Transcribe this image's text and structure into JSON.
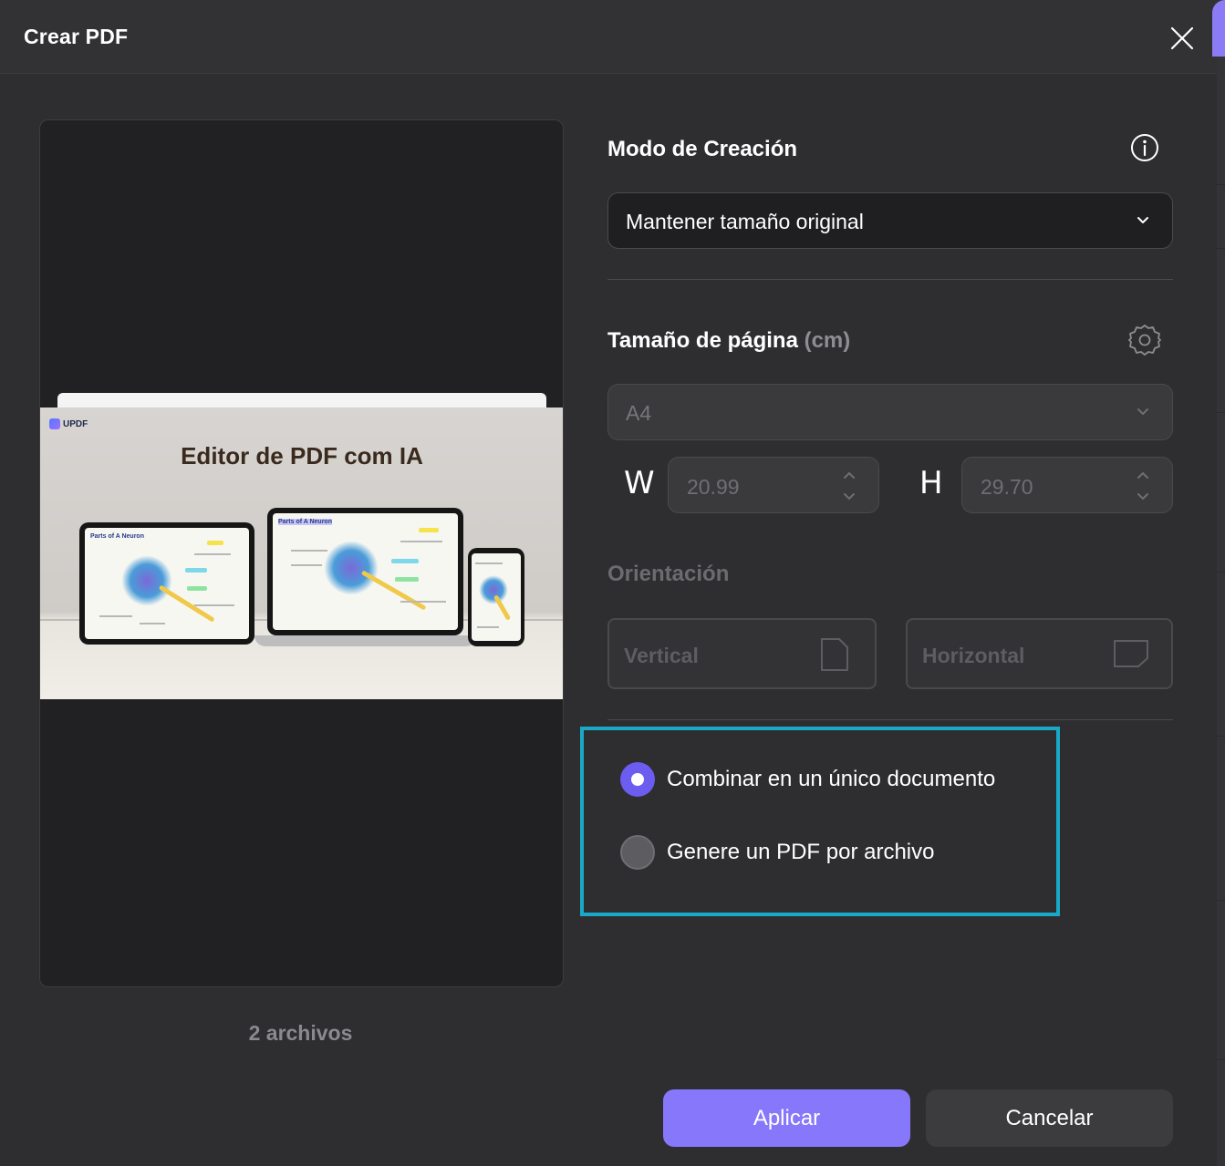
{
  "dialog": {
    "title": "Crear PDF"
  },
  "preview": {
    "logo_text": "UPDF",
    "page_heading": "Editor de PDF com IA",
    "screen_labels": [
      "Parts of A Neuron",
      "Parts of A Neuron"
    ],
    "files_count": "2 archivos"
  },
  "creation_mode": {
    "title": "Modo de Creación",
    "selected": "Mantener tamaño original"
  },
  "page_size": {
    "title": "Tamaño de página",
    "unit": "(cm)",
    "preset": "A4",
    "width_label": "W",
    "height_label": "H",
    "width_value": "20.99",
    "height_value": "29.70"
  },
  "orientation": {
    "title": "Orientación",
    "vertical": "Vertical",
    "horizontal": "Horizontal"
  },
  "output_options": {
    "combine": "Combinar en un único documento",
    "per_file": "Genere un PDF por archivo",
    "selected": "combine"
  },
  "buttons": {
    "apply": "Aplicar",
    "cancel": "Cancelar"
  },
  "colors": {
    "accent": "#8677fb",
    "radio_checked": "#6c5cf0",
    "highlight_border": "#1aa8c9",
    "background": "#2e2e30"
  },
  "icons": {
    "close": "close-icon",
    "info": "info-icon",
    "settings": "gear-icon",
    "dropdown": "chevron-down-icon",
    "stepper": "stepper-arrows-icon",
    "portrait": "portrait-page-icon",
    "landscape": "landscape-page-icon"
  }
}
